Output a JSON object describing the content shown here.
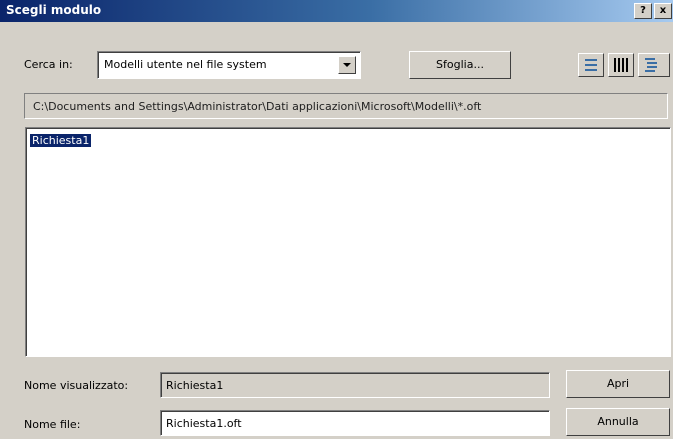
{
  "window": {
    "title": "Scegli modulo",
    "help_button": "?",
    "close_button": "x"
  },
  "lookin": {
    "label": "Cerca in:",
    "value": "Modelli utente nel file system",
    "browse_button": "Sfoglia..."
  },
  "view_buttons": [
    {
      "name": "large-icons-view-icon"
    },
    {
      "name": "list-view-icon"
    },
    {
      "name": "details-view-icon"
    }
  ],
  "path": {
    "value": "C:\\Documents and Settings\\Administrator\\Dati applicazioni\\Microsoft\\Modelli\\*.oft"
  },
  "file_list": {
    "items": [
      "Richiesta1"
    ],
    "selected": "Richiesta1"
  },
  "fields": {
    "display_name_label": "Nome visualizzato:",
    "display_name_value": "Richiesta1",
    "file_name_label": "Nome file:",
    "file_name_value": "Richiesta1.oft"
  },
  "buttons": {
    "open": "Apri",
    "cancel": "Annulla"
  },
  "colors": {
    "title_bar_start": "#0a246a",
    "title_bar_end": "#a6caf0",
    "dialog_bg": "#d4d0c8",
    "selection": "#0a246a"
  }
}
